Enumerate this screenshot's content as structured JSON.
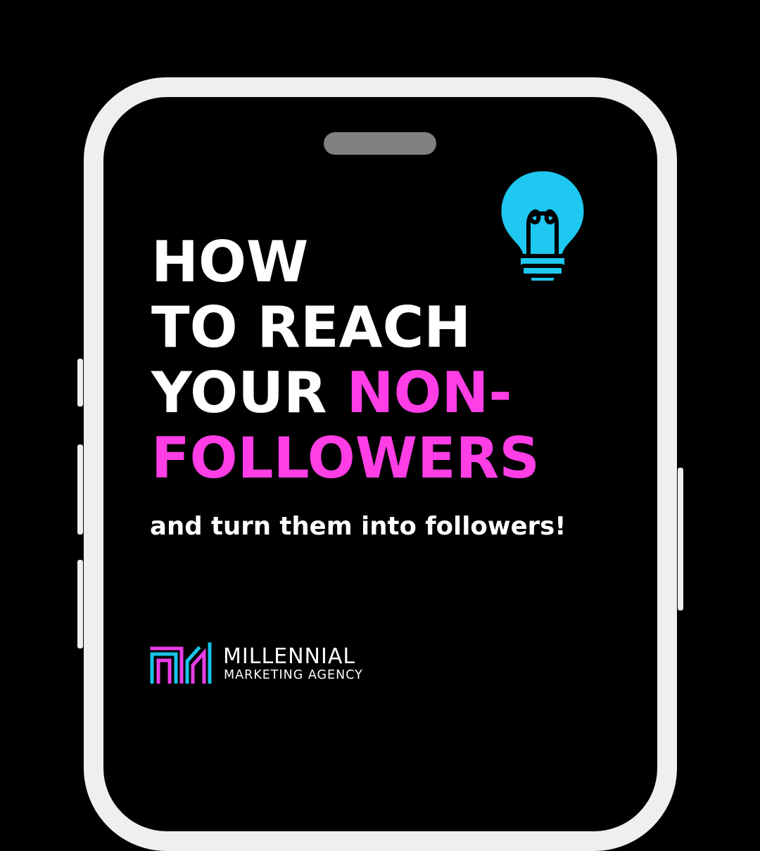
{
  "colors": {
    "background": "#000000",
    "phone_frame": "#efefef",
    "notch": "#808080",
    "text": "#ffffff",
    "accent_pink": "#ff3ee6",
    "bulb_fill": "#1ec8f0",
    "logo_cyan": "#17c4e8",
    "logo_magenta": "#e83ee6"
  },
  "icons": {
    "bulb": "lightbulb-icon",
    "logo": "millennial-m-logo-icon"
  },
  "headline": {
    "line1": "HOW",
    "line2": "TO REACH",
    "line3_plain": "YOUR ",
    "line3_accent": "NON-",
    "line4_accent": "FOLLOWERS"
  },
  "subline": "and turn them into followers!",
  "logo": {
    "name": "MILLENNIAL",
    "tagline": "MARKETING AGENCY"
  }
}
